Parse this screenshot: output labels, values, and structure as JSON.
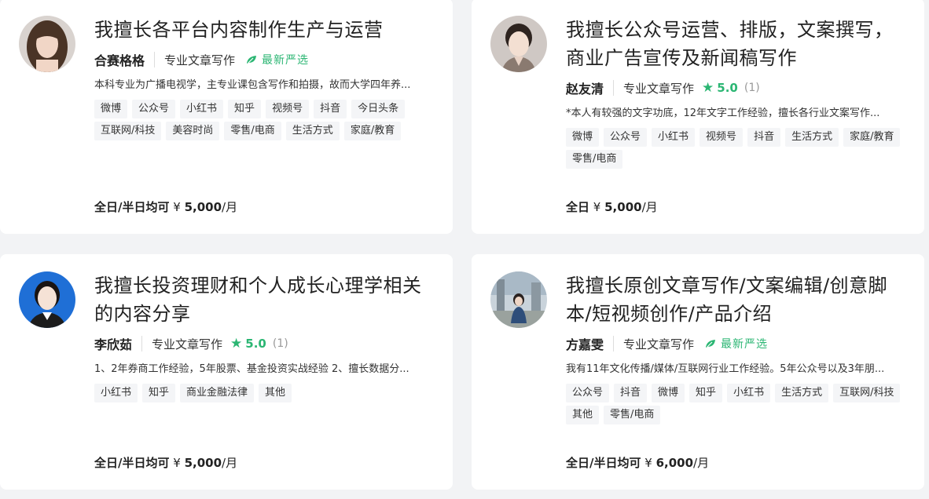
{
  "cards": [
    {
      "title": "我擅长各平台内容制作生产与运营",
      "name": "合赛格格",
      "role": "专业文章写作",
      "badge": "最新严选",
      "description": "本科专业为广播电视学，主专业课包含写作和拍摄，故而大学四年养...",
      "tags": [
        "微博",
        "公众号",
        "小红书",
        "知乎",
        "视频号",
        "抖音",
        "今日头条",
        "互联网/科技",
        "美容时尚",
        "零售/电商",
        "生活方式",
        "家庭/教育"
      ],
      "price_lead": "全日/半日均可",
      "price_symbol": "¥",
      "price_amount": "5,000",
      "price_unit": "/月"
    },
    {
      "title": "我擅长公众号运营、排版，文案撰写，商业广告宣传及新闻稿写作",
      "name": "赵友清",
      "role": "专业文章写作",
      "rating": "5.0",
      "rating_count": "(1)",
      "description": "*本人有较强的文字功底，12年文字工作经验，擅长各行业文案写作...",
      "tags": [
        "微博",
        "公众号",
        "小红书",
        "视频号",
        "抖音",
        "生活方式",
        "家庭/教育",
        "零售/电商"
      ],
      "price_lead": "全日",
      "price_symbol": "¥",
      "price_amount": "5,000",
      "price_unit": "/月"
    },
    {
      "title": "我擅长投资理财和个人成长心理学相关的内容分享",
      "name": "李欣茹",
      "role": "专业文章写作",
      "rating": "5.0",
      "rating_count": "(1)",
      "description": "1、2年券商工作经验，5年股票、基金投资实战经验 2、擅长数据分...",
      "tags": [
        "小红书",
        "知乎",
        "商业金融法律",
        "其他"
      ],
      "price_lead": "全日/半日均可",
      "price_symbol": "¥",
      "price_amount": "5,000",
      "price_unit": "/月"
    },
    {
      "title": "我擅长原创文章写作/文案编辑/创意脚本/短视频创作/产品介绍",
      "name": "方嘉雯",
      "role": "专业文章写作",
      "badge": "最新严选",
      "description": "我有11年文化传播/媒体/互联网行业工作经验。5年公众号以及3年朋...",
      "tags": [
        "公众号",
        "抖音",
        "微博",
        "知乎",
        "小红书",
        "生活方式",
        "互联网/科技",
        "其他",
        "零售/电商"
      ],
      "price_lead": "全日/半日均可",
      "price_symbol": "¥",
      "price_amount": "6,000",
      "price_unit": "/月"
    }
  ],
  "colors": {
    "accent_green": "#2bb673",
    "background": "#f2f3f5"
  }
}
